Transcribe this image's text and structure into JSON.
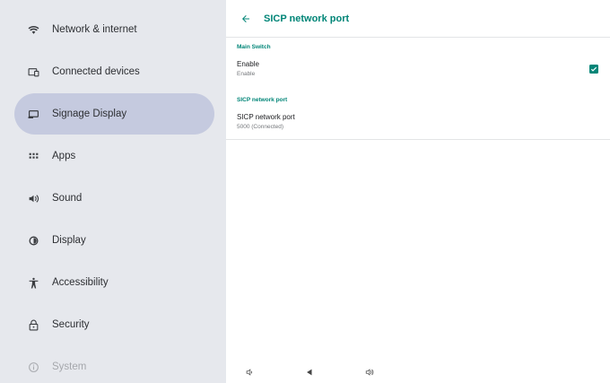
{
  "sidebar": {
    "items": [
      {
        "label": "Network & internet",
        "icon": "wifi-icon"
      },
      {
        "label": "Connected devices",
        "icon": "connected-devices-icon"
      },
      {
        "label": "Signage Display",
        "icon": "signage-display-icon",
        "active": true
      },
      {
        "label": "Apps",
        "icon": "apps-grid-icon"
      },
      {
        "label": "Sound",
        "icon": "volume-icon"
      },
      {
        "label": "Display",
        "icon": "brightness-icon"
      },
      {
        "label": "Accessibility",
        "icon": "accessibility-icon"
      },
      {
        "label": "Security",
        "icon": "lock-icon"
      },
      {
        "label": "System",
        "icon": "info-icon"
      }
    ]
  },
  "header": {
    "title": "SICP network port",
    "back_icon": "back-arrow-icon"
  },
  "sections": {
    "main_switch": {
      "header": "Main Switch",
      "enable_title": "Enable",
      "enable_summary": "Enable",
      "enable_checked": true
    },
    "port": {
      "header": "SICP network port",
      "title": "SICP network port",
      "summary": "5000 (Connected)"
    }
  },
  "navbar": {
    "icons": [
      "volume-down-icon",
      "back-triangle-icon",
      "volume-up-icon"
    ]
  },
  "colors": {
    "accent": "#008577",
    "sidebar_bg": "#e6e8ed",
    "active_bg": "#c5cadf"
  }
}
